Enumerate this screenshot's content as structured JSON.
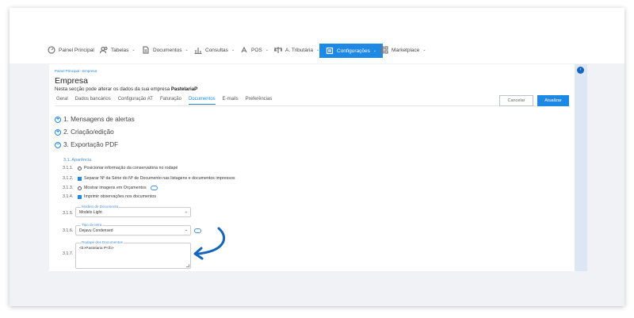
{
  "nav": {
    "items": [
      {
        "label": "Painel Principal",
        "icon": "gauge-icon",
        "has_menu": false
      },
      {
        "label": "Tabelas",
        "icon": "users-icon",
        "has_menu": true
      },
      {
        "label": "Documentos",
        "icon": "document-icon",
        "has_menu": true
      },
      {
        "label": "Consultas",
        "icon": "bar-chart-icon",
        "has_menu": true
      },
      {
        "label": "POS",
        "icon": "pos-icon",
        "has_menu": true
      },
      {
        "label": "A. Tributária",
        "icon": "scale-icon",
        "has_menu": true
      },
      {
        "label": "Configurações",
        "icon": "settings-icon",
        "has_menu": true,
        "active": true
      },
      {
        "label": "Marketplace",
        "icon": "grid-icon",
        "has_menu": true
      }
    ],
    "chevron": "⌄",
    "active_color": "#1e88e5"
  },
  "breadcrumb": {
    "home": "Painel Principal",
    "separator": "›",
    "current": "Empresa"
  },
  "page": {
    "title": "Empresa",
    "subtitle_prefix": "Nesta secção pode alterar os dados da sua empresa",
    "company": "PastelariaP"
  },
  "tabs": [
    {
      "label": "Geral"
    },
    {
      "label": "Dados bancários"
    },
    {
      "label": "Configuração AT"
    },
    {
      "label": "Faturação"
    },
    {
      "label": "Documentos",
      "active": true
    },
    {
      "label": "E-mails"
    },
    {
      "label": "Preferências"
    }
  ],
  "actions": {
    "cancel": "Cancelar",
    "save": "Atualizar"
  },
  "sections": [
    {
      "label": "1. Mensagens de alertas",
      "state": "+"
    },
    {
      "label": "2. Criação/edição",
      "state": "+"
    },
    {
      "label": "3. Exportação PDF",
      "state": "−"
    }
  ],
  "subsection": "3.1. Aparência",
  "options": [
    {
      "num": "3.1.1.",
      "control": "radio",
      "label": "Posicionar informação da conservatória no rodapé"
    },
    {
      "num": "3.1.2.",
      "control": "checkbox-checked",
      "label": "Separar Nº da Série do Nº de Documento nas listagens e documentos impressos"
    },
    {
      "num": "3.1.3.",
      "control": "radio",
      "label": "Mostrar imagens em Orçamentos",
      "help": true
    },
    {
      "num": "3.1.4.",
      "control": "checkbox-checked",
      "label": "Imprimir observações nos documentos"
    }
  ],
  "fields": {
    "model": {
      "num": "3.1.5.",
      "legend": "Modelo de Documento",
      "value": "Modelo Light"
    },
    "font": {
      "num": "3.1.6.",
      "legend": "Tipo de letra",
      "value": "Dejavu Condensed"
    },
    "footer": {
      "num": "3.1.7.",
      "legend": "Rodapé dos Documentos",
      "value": "<b>Pastelaria P</b>"
    }
  },
  "colors": {
    "accent": "#1e88e5",
    "background": "#f1f2f6",
    "rightbar": "#dde6f3"
  }
}
